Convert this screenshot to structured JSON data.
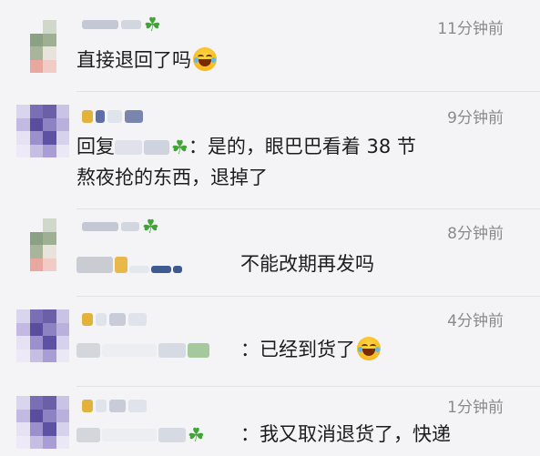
{
  "comments": [
    {
      "time": "11分钟前",
      "body": "直接退回了吗",
      "emoji": "laugh-cry-emoji"
    },
    {
      "time": "9分钟前",
      "reply_prefix": "回复",
      "line1_suffix": "：是的，眼巴巴看着 38 节",
      "line2": "熬夜抢的东西，退掉了"
    },
    {
      "time": "8分钟前",
      "body": "不能改期再发吗"
    },
    {
      "time": "4分钟前",
      "body": "：已经到货了",
      "emoji": "laugh-cry-emoji"
    },
    {
      "time": "1分钟前",
      "body": "：我又取消退货了，快递"
    }
  ],
  "icons": {
    "clover": "four-leaf-clover-icon"
  },
  "colors": {
    "background": "#f4f4f6",
    "time": "#8a8a8e",
    "clover": "#3fa535"
  }
}
